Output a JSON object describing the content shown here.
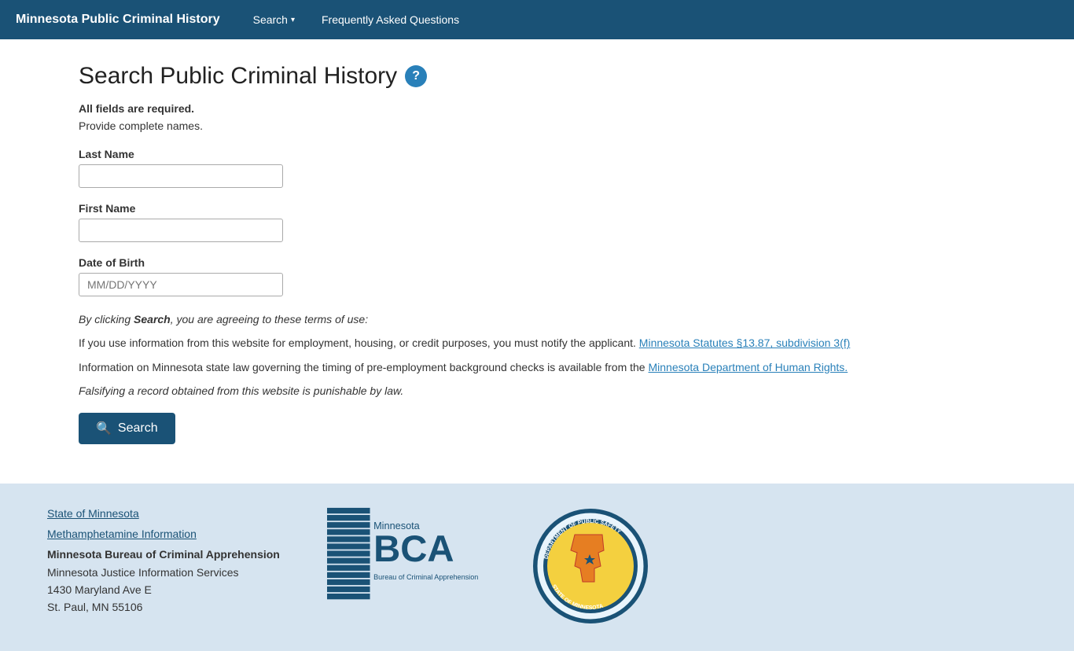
{
  "navbar": {
    "brand": "Minnesota Public Criminal History",
    "search_label": "Search",
    "faq_label": "Frequently Asked Questions"
  },
  "page": {
    "title": "Search Public Criminal History",
    "required_note": "All fields are required.",
    "provide_note": "Provide complete names.",
    "last_name_label": "Last Name",
    "first_name_label": "First Name",
    "dob_label": "Date of Birth",
    "dob_placeholder": "MM/DD/YYYY",
    "terms_line1_pre": "By clicking ",
    "terms_line1_bold": "Search",
    "terms_line1_post": ", you are agreeing to these terms of use:",
    "terms_line2_pre": "If you use information from this website for employment, housing, or credit purposes, you must notify the applicant. ",
    "terms_line2_link": "Minnesota Statutes §13.87, subdivision 3(f)",
    "terms_line3_pre": "Information on Minnesota state law governing the timing of pre-employment background checks is available from the ",
    "terms_line3_link": "Minnesota Department of Human Rights.",
    "terms_line4": "Falsifying a record obtained from this website is punishable by law.",
    "search_button": "Search"
  },
  "footer": {
    "state_link": "State of Minnesota",
    "meth_link": "Methamphetamine Information",
    "org_name": "Minnesota Bureau of Criminal Apprehension",
    "org_sub": "Minnesota Justice Information Services",
    "address1": "1430 Maryland Ave E",
    "address2": "St. Paul, MN 55106"
  }
}
